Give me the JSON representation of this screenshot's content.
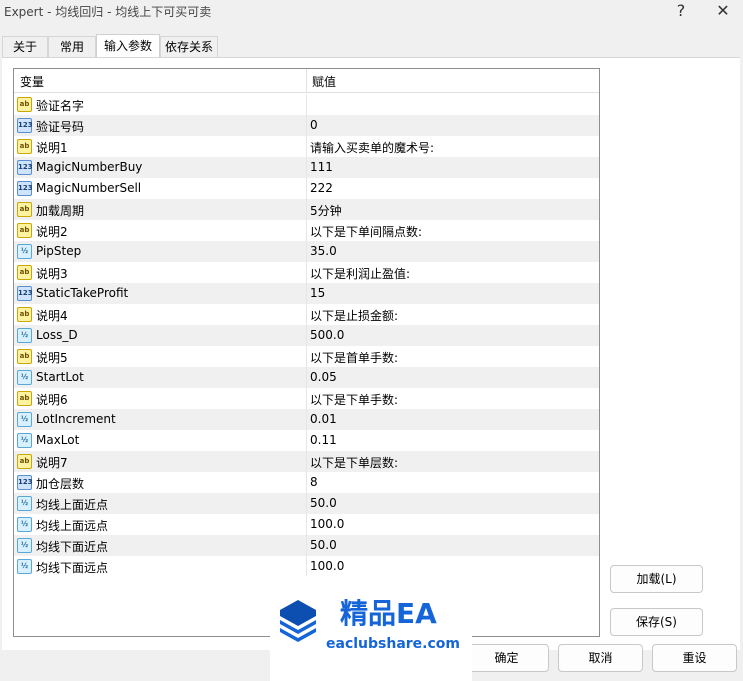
{
  "window": {
    "title": "Expert - 均线回归 - 均线上下可买可卖",
    "help_glyph": "?",
    "close_glyph": "✕"
  },
  "tabs": [
    {
      "label": "关于"
    },
    {
      "label": "常用"
    },
    {
      "label": "输入参数"
    },
    {
      "label": "依存关系"
    }
  ],
  "grid": {
    "col_variable": "变量",
    "col_value": "赋值",
    "rows": [
      {
        "type": "string",
        "icon": "ab",
        "name": "验证名字",
        "value": ""
      },
      {
        "type": "int",
        "icon": "123",
        "name": "验证号码",
        "value": "0"
      },
      {
        "type": "string",
        "icon": "ab",
        "name": "说明1",
        "value": "请输入买卖单的魔术号:"
      },
      {
        "type": "int",
        "icon": "123",
        "name": "MagicNumberBuy",
        "value": "111"
      },
      {
        "type": "int",
        "icon": "123",
        "name": "MagicNumberSell",
        "value": "222"
      },
      {
        "type": "string",
        "icon": "ab",
        "name": "加载周期",
        "value": " 5分钟"
      },
      {
        "type": "string",
        "icon": "ab",
        "name": "说明2",
        "value": "以下是下单间隔点数:"
      },
      {
        "type": "double",
        "icon": "½",
        "name": "PipStep",
        "value": "35.0"
      },
      {
        "type": "string",
        "icon": "ab",
        "name": "说明3",
        "value": "以下是利润止盈值:"
      },
      {
        "type": "int",
        "icon": "123",
        "name": "StaticTakeProfit",
        "value": "15"
      },
      {
        "type": "string",
        "icon": "ab",
        "name": "说明4",
        "value": "以下是止损金额:"
      },
      {
        "type": "double",
        "icon": "½",
        "name": "Loss_D",
        "value": "500.0"
      },
      {
        "type": "string",
        "icon": "ab",
        "name": "说明5",
        "value": "以下是首单手数:"
      },
      {
        "type": "double",
        "icon": "½",
        "name": "StartLot",
        "value": "0.05"
      },
      {
        "type": "string",
        "icon": "ab",
        "name": "说明6",
        "value": "以下是下单手数:"
      },
      {
        "type": "double",
        "icon": "½",
        "name": "LotIncrement",
        "value": "0.01"
      },
      {
        "type": "double",
        "icon": "½",
        "name": "MaxLot",
        "value": "0.11"
      },
      {
        "type": "string",
        "icon": "ab",
        "name": "说明7",
        "value": "以下是下单层数:"
      },
      {
        "type": "int",
        "icon": "123",
        "name": "加仓层数",
        "value": "8"
      },
      {
        "type": "double",
        "icon": "½",
        "name": "均线上面近点",
        "value": "50.0"
      },
      {
        "type": "double",
        "icon": "½",
        "name": "均线上面远点",
        "value": "100.0"
      },
      {
        "type": "double",
        "icon": "½",
        "name": "均线下面近点",
        "value": "50.0"
      },
      {
        "type": "double",
        "icon": "½",
        "name": "均线下面远点",
        "value": "100.0"
      }
    ]
  },
  "buttons": {
    "load": "加载(L)",
    "save": "保存(S)",
    "ok": "确定",
    "cancel": "取消",
    "reset": "重设"
  },
  "watermark": {
    "line1": "精品EA",
    "line2": "eaclubshare.com"
  },
  "colors": {
    "accent": "#1565d8",
    "row_alt": "#f0f0f0"
  }
}
